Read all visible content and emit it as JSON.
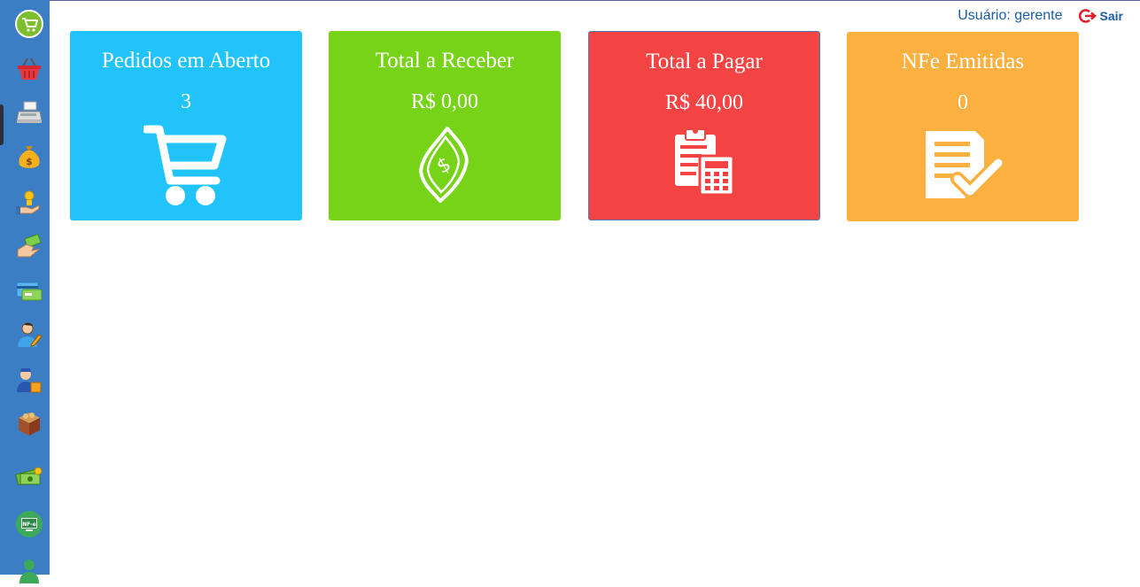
{
  "header": {
    "user_label": "Usuário: gerente",
    "logout_label": "Sair"
  },
  "sidebar": {
    "items": [
      {
        "name": "home-cart-icon"
      },
      {
        "name": "basket-icon"
      },
      {
        "name": "cash-register-icon"
      },
      {
        "name": "money-bag-icon"
      },
      {
        "name": "hand-coin-icon"
      },
      {
        "name": "payment-hand-icon"
      },
      {
        "name": "credit-card-icon"
      },
      {
        "name": "user-edit-icon"
      },
      {
        "name": "supplier-icon"
      },
      {
        "name": "product-box-icon"
      },
      {
        "name": "money-stack-icon"
      },
      {
        "name": "nfe-icon"
      },
      {
        "name": "user-icon"
      }
    ]
  },
  "cards": [
    {
      "title": "Pedidos em Aberto",
      "value": "3",
      "color": "#21c4fa",
      "icon": "cart-icon"
    },
    {
      "title": "Total a Receber",
      "value": "R$ 0,00",
      "color": "#77d317",
      "icon": "money-bill-icon"
    },
    {
      "title": "Total a Pagar",
      "value": "R$ 40,00",
      "color": "#f44343",
      "icon": "clipboard-calculator-icon"
    },
    {
      "title": "NFe Emitidas",
      "value": "0",
      "color": "#fcb040",
      "icon": "document-check-icon"
    }
  ]
}
